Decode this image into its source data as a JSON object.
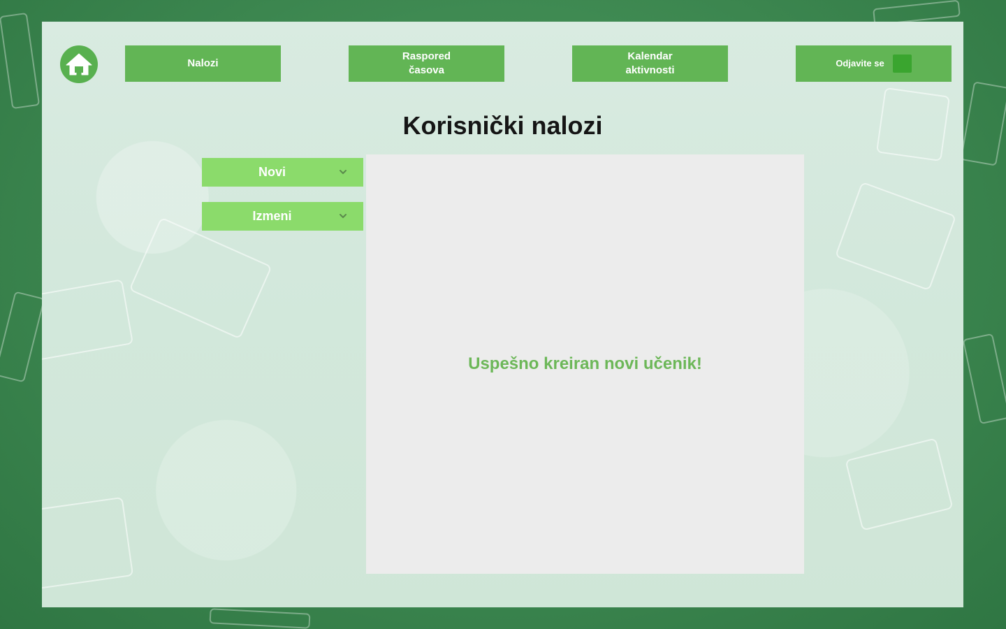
{
  "nav": {
    "home_icon": "home-icon",
    "items": [
      {
        "lines": [
          "Nalozi"
        ]
      },
      {
        "lines": [
          "Raspored",
          "časova"
        ]
      },
      {
        "lines": [
          "Kalendar",
          "aktivnosti"
        ]
      }
    ],
    "logout_label": "Odjavite se"
  },
  "page": {
    "title": "Korisnički nalozi"
  },
  "sidebar": {
    "items": [
      {
        "label": "Novi",
        "icon": "chevron-down-icon"
      },
      {
        "label": "Izmeni",
        "icon": "chevron-down-icon"
      }
    ]
  },
  "main": {
    "message": "Uspešno kreiran novi učenik!"
  },
  "colors": {
    "nav_button": "#62b555",
    "side_button": "#8bdb6b",
    "message": "#6cb758",
    "frame": "#3f8a52"
  }
}
